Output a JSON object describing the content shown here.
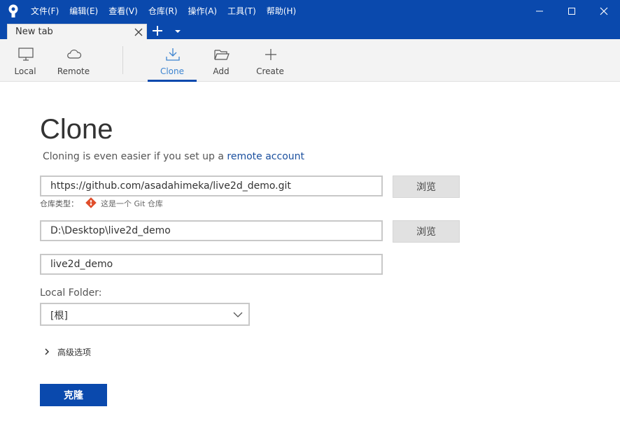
{
  "menu": [
    "文件(F)",
    "编辑(E)",
    "查看(V)",
    "仓库(R)",
    "操作(A)",
    "工具(T)",
    "帮助(H)"
  ],
  "window_controls": {
    "minimize_icon": "minimize-icon",
    "maximize_icon": "maximize-icon",
    "close_icon": "close-icon"
  },
  "tab": {
    "label": "New tab"
  },
  "toolbar": {
    "local": "Local",
    "remote": "Remote",
    "clone": "Clone",
    "add": "Add",
    "create": "Create",
    "active": "Clone"
  },
  "clone": {
    "title": "Clone",
    "subtitle_prefix": "Cloning is even easier if you set up a ",
    "subtitle_link": "remote account",
    "source_url": "https://github.com/asadahimeka/live2d_demo.git",
    "browse1": "浏览",
    "repo_type_label": "仓库类型：",
    "repo_type_value": "这是一个 Git 仓库",
    "dest_path": "D:\\Desktop\\live2d_demo",
    "browse2": "浏览",
    "name": "live2d_demo",
    "local_folder_label": "Local Folder:",
    "local_folder_value": "[根]",
    "advanced_label": "高级选项",
    "clone_button": "克隆"
  },
  "colors": {
    "brand": "#0a49ad",
    "link": "#1a4f9e",
    "active_tab_text": "#3d84d0",
    "git": "#e04e2b"
  }
}
